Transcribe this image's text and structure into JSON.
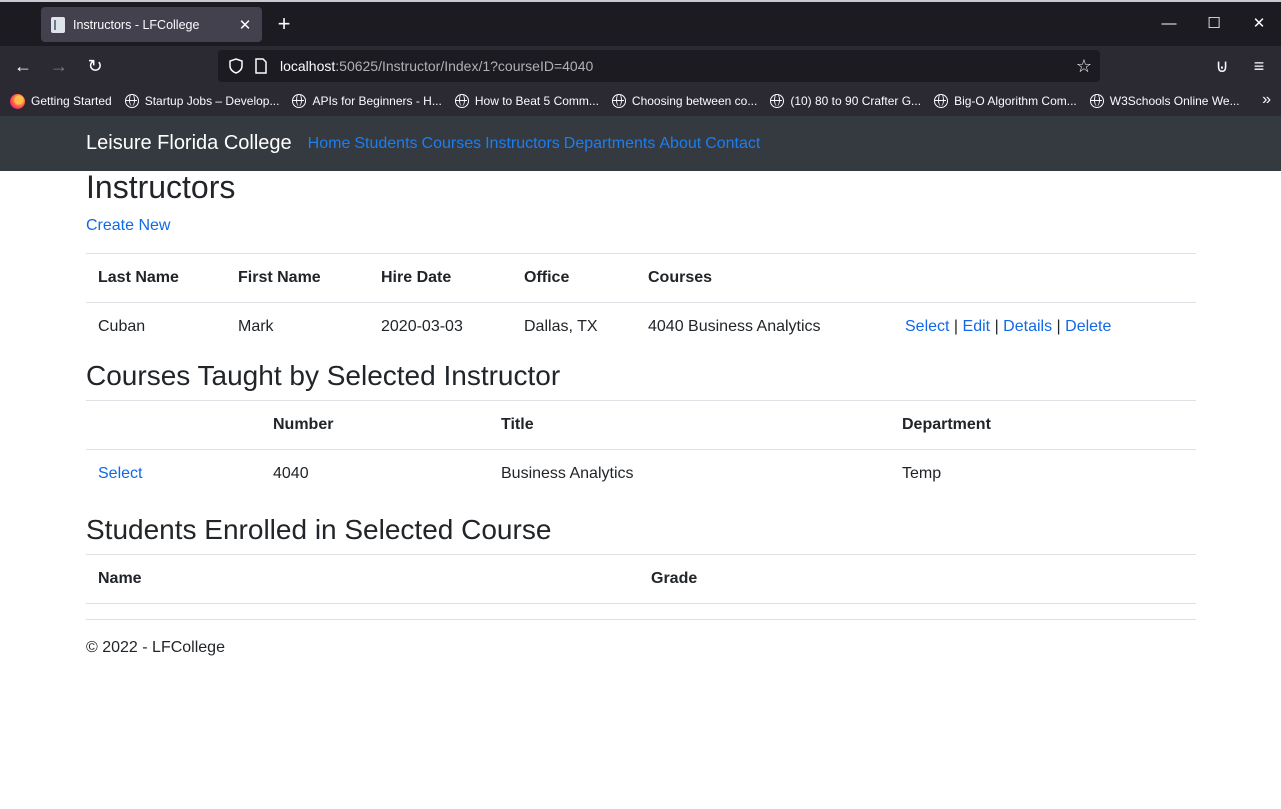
{
  "browser": {
    "tab_title": "Instructors - LFCollege",
    "tab_close": "✕",
    "new_tab": "+",
    "window": {
      "minimize": "—",
      "maximize": "☐",
      "close": "✕"
    },
    "nav": {
      "back": "←",
      "forward": "→",
      "reload": "↻"
    },
    "url_host": "localhost",
    "url_rest": ":50625/Instructor/Index/1?courseID=4040",
    "star": "☆",
    "menu": "≡",
    "pocket": "⊍",
    "bookmarks": [
      {
        "label": "Getting Started",
        "icon": "firefox-icon"
      },
      {
        "label": "Startup Jobs – Develop...",
        "icon": "globe-icon"
      },
      {
        "label": "APIs for Beginners - H...",
        "icon": "globe-icon"
      },
      {
        "label": "How to Beat 5 Comm...",
        "icon": "globe-icon"
      },
      {
        "label": "Choosing between co...",
        "icon": "globe-icon"
      },
      {
        "label": "(10) 80 to 90 Crafter G...",
        "icon": "globe-icon"
      },
      {
        "label": "Big-O Algorithm Com...",
        "icon": "globe-icon"
      },
      {
        "label": "W3Schools Online We...",
        "icon": "globe-icon"
      }
    ],
    "bookmarks_more": "»"
  },
  "site": {
    "brand": "Leisure Florida College",
    "nav": [
      "Home",
      "Students",
      "Courses",
      "Instructors",
      "Departments",
      "About",
      "Contact"
    ]
  },
  "page": {
    "title": "Instructors",
    "create_new": "Create New",
    "instructors_table": {
      "headers": [
        "Last Name",
        "First Name",
        "Hire Date",
        "Office",
        "Courses",
        ""
      ],
      "rows": [
        {
          "last_name": "Cuban",
          "first_name": "Mark",
          "hire_date": "2020-03-03",
          "office": "Dallas, TX",
          "courses": "4040 Business Analytics",
          "actions": [
            "Select",
            "Edit",
            "Details",
            "Delete"
          ]
        }
      ],
      "separator": "|"
    },
    "courses_heading": "Courses Taught by Selected Instructor",
    "courses_table": {
      "headers": [
        "",
        "Number",
        "Title",
        "Department"
      ],
      "rows": [
        {
          "action": "Select",
          "number": "4040",
          "title": "Business Analytics",
          "department": "Temp"
        }
      ]
    },
    "students_heading": "Students Enrolled in Selected Course",
    "students_table": {
      "headers": [
        "Name",
        "Grade"
      ]
    },
    "footer": "© 2022 - LFCollege"
  }
}
